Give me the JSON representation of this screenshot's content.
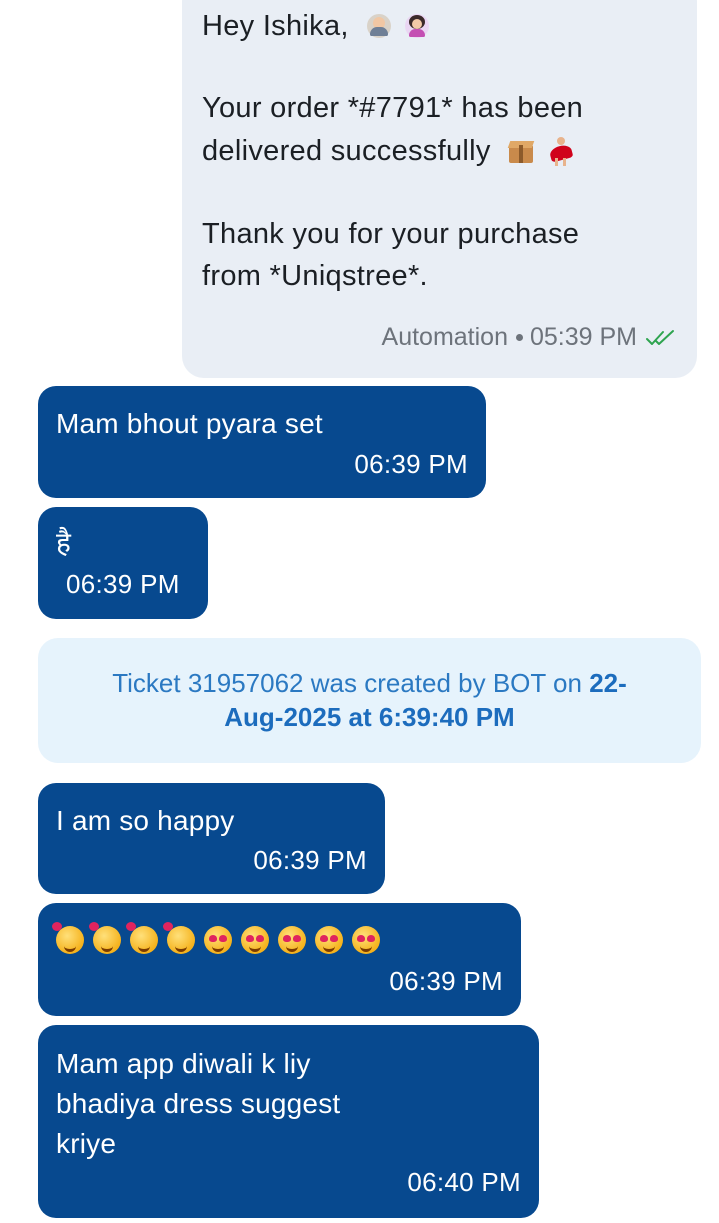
{
  "outgoing": {
    "greeting": "Hey Ishika,",
    "greeting_emojis": [
      "person-emoji",
      "woman-emoji"
    ],
    "line1": "Your order *#7791* has been",
    "line2": "delivered successfully",
    "line2_emojis": [
      "package-emoji",
      "dancer-emoji"
    ],
    "line3": "Thank you for your purchase",
    "line4": "from *Uniqstree*.",
    "sender": "Automation",
    "time": "05:39 PM",
    "status_icon": "double-check-icon",
    "status_color": "#2ea44f"
  },
  "incoming": [
    {
      "text": "Mam bhout pyara set",
      "time": "06:39 PM"
    },
    {
      "text": "है",
      "time": "06:39 PM"
    },
    {
      "text": "I am so happy",
      "time": "06:39 PM"
    },
    {
      "emojis": [
        "smiling-face-with-hearts",
        "smiling-face-with-hearts",
        "smiling-face-with-hearts",
        "smiling-face-with-hearts",
        "heart-eyes",
        "heart-eyes",
        "heart-eyes",
        "heart-eyes",
        "heart-eyes"
      ],
      "time": "06:39 PM"
    },
    {
      "lines": [
        "Mam app diwali k liy",
        "bhadiya dress suggest",
        "kriye"
      ],
      "time": "06:40 PM"
    }
  ],
  "system_note": {
    "prefix": "Ticket 31957062 was created by BOT on",
    "date_part1": "22-",
    "date_part2": "Aug-2025 at 6:39:40 PM"
  },
  "colors": {
    "incoming_bubble": "#07498f",
    "outgoing_bubble": "#e9eef5",
    "system_note_bg": "#e6f3fc",
    "system_note_text": "#2b79c2"
  }
}
